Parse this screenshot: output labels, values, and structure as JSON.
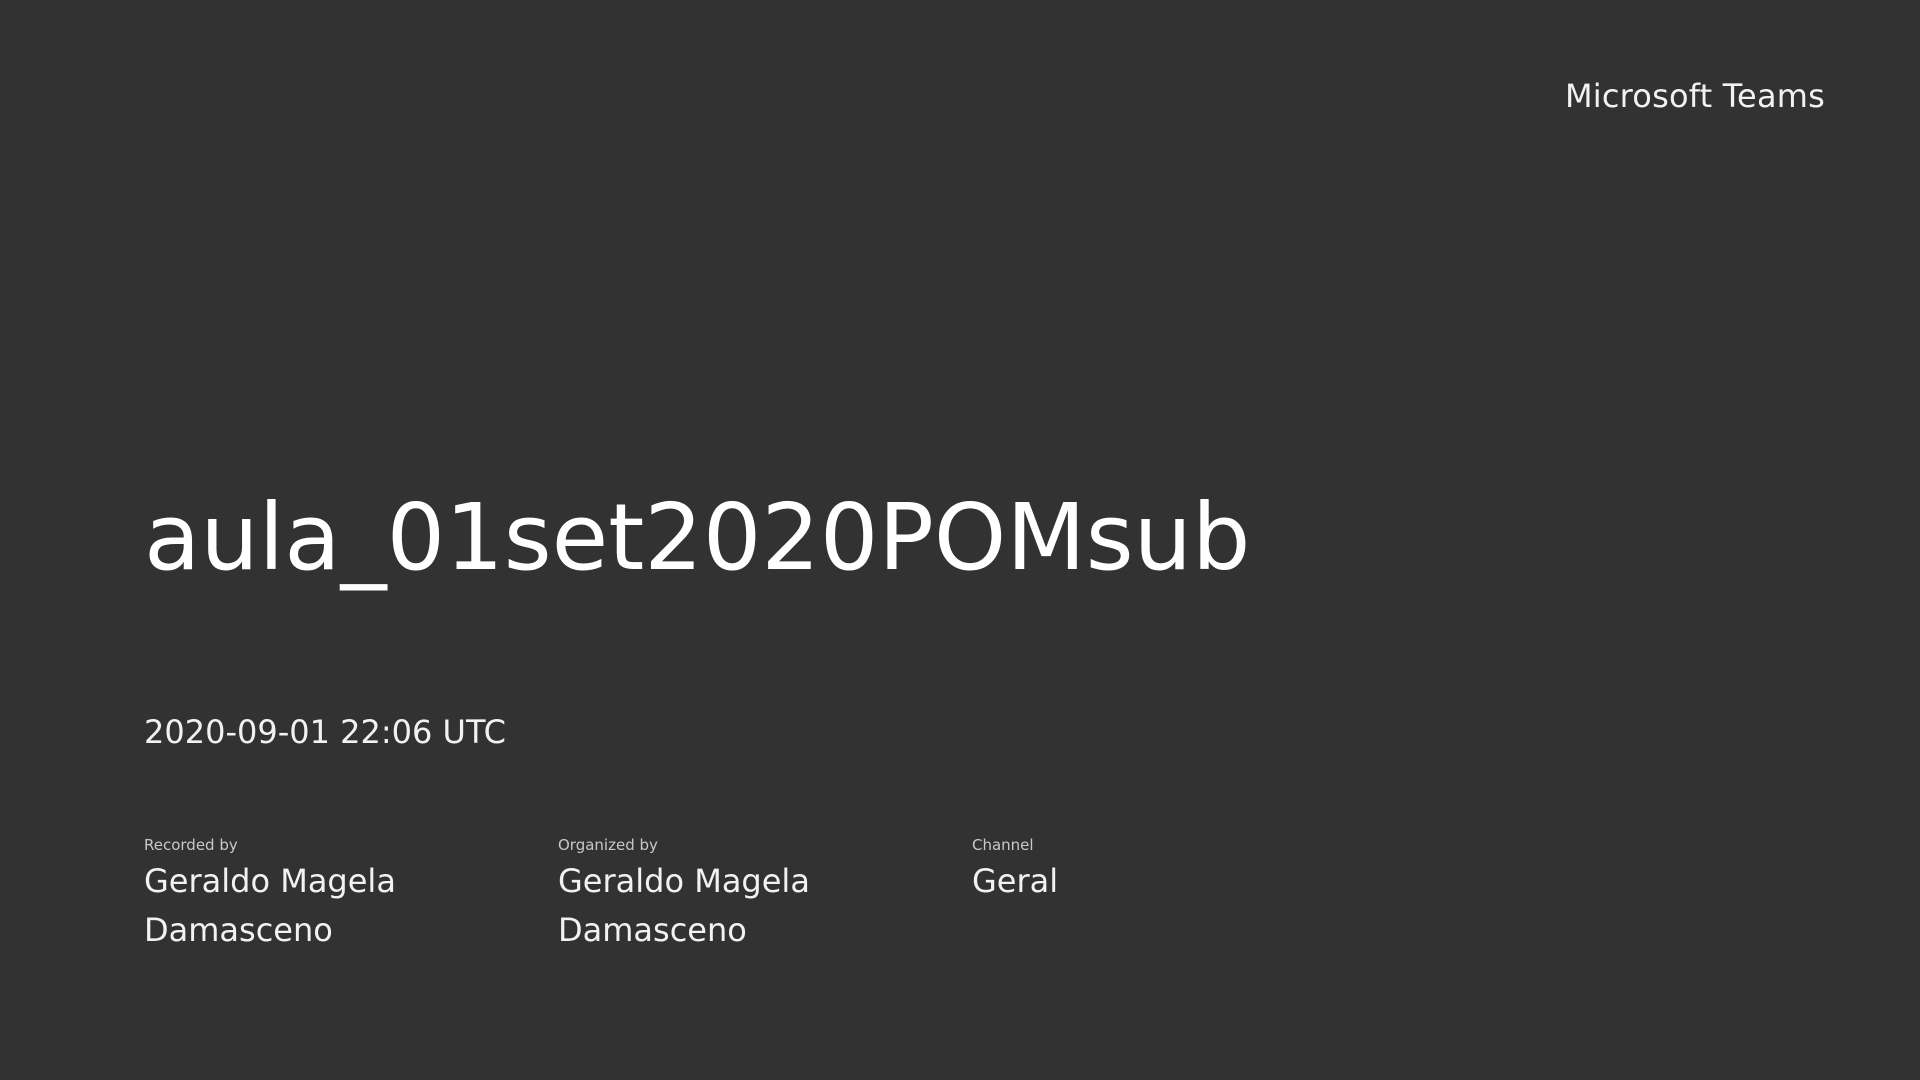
{
  "brand": "Microsoft Teams",
  "meeting": {
    "title": "aula_01set2020POMsub",
    "timestamp": "2020-09-01 22:06 UTC"
  },
  "details": [
    {
      "label": "Recorded by",
      "value": "Geraldo Magela Damasceno"
    },
    {
      "label": "Organized by",
      "value": "Geraldo Magela Damasceno"
    },
    {
      "label": "Channel",
      "value": "Geral"
    }
  ],
  "colors": {
    "background": "#323232",
    "text": "#ffffff",
    "label_text": "#c8c8c8"
  }
}
